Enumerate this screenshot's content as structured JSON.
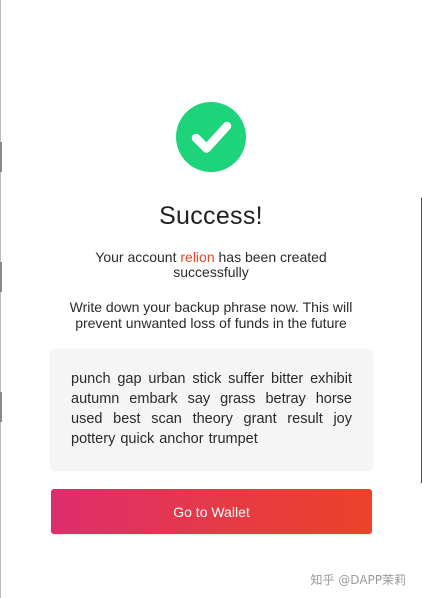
{
  "success": {
    "title": "Success!",
    "account_prefix": "Your account ",
    "account_name": "relion",
    "account_suffix": " has been created successfully",
    "backup_message": "Write down your backup phrase now. This will prevent unwanted loss of funds in the future"
  },
  "phrase": {
    "text": "punch gap urban stick suffer bitter exhibit autumn embark say grass betray horse used best scan theory grant result joy pottery quick anchor trumpet"
  },
  "actions": {
    "go_to_wallet_label": "Go to Wallet"
  },
  "watermark": {
    "text": "知乎 @DAPP茉莉"
  },
  "colors": {
    "success_green": "#1ed47a",
    "account_name_red": "#e44b2a",
    "button_gradient_start": "#de2d6e",
    "button_gradient_end": "#ec4228"
  },
  "icons": {
    "success": "check-circle-icon"
  }
}
